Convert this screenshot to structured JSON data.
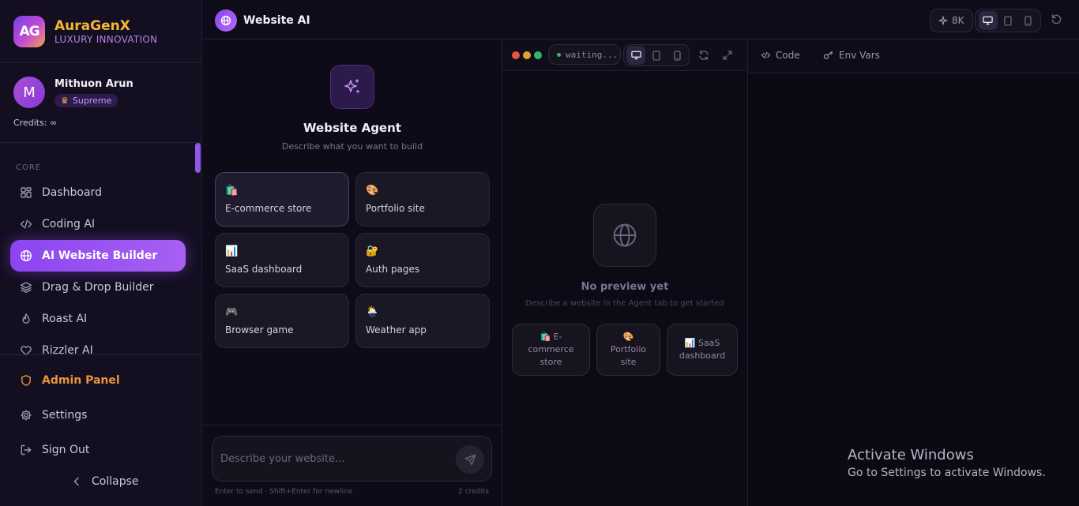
{
  "brand": {
    "logo_text": "AG",
    "name": "AuraGenX",
    "tagline": "LUXURY INNOVATION"
  },
  "user": {
    "avatar_initial": "M",
    "name": "Mithuon Arun",
    "badge": "Supreme",
    "credits": "Credits: ∞"
  },
  "sidebar": {
    "section": "CORE",
    "items": [
      {
        "label": "Dashboard",
        "icon": "grid-icon"
      },
      {
        "label": "Coding AI",
        "icon": "code-icon"
      },
      {
        "label": "AI Website Builder",
        "icon": "globe-icon",
        "active": true
      },
      {
        "label": "Drag & Drop Builder",
        "icon": "layers-icon"
      },
      {
        "label": "Roast AI",
        "icon": "flame-icon"
      },
      {
        "label": "Rizzler AI",
        "icon": "heart-icon"
      }
    ],
    "footer": [
      {
        "label": "Admin Panel",
        "icon": "shield-icon"
      },
      {
        "label": "Settings",
        "icon": "gear-icon"
      },
      {
        "label": "Sign Out",
        "icon": "sign-out-icon"
      }
    ],
    "collapse": "Collapse"
  },
  "topbar": {
    "title": "Website AI",
    "quality": "8K"
  },
  "agent": {
    "title": "Website Agent",
    "subtitle": "Describe what you want to build",
    "templates": [
      {
        "emoji": "🛍️",
        "label": "E-commerce store"
      },
      {
        "emoji": "🎨",
        "label": "Portfolio site"
      },
      {
        "emoji": "📊",
        "label": "SaaS dashboard"
      },
      {
        "emoji": "🔐",
        "label": "Auth pages"
      },
      {
        "emoji": "🎮",
        "label": "Browser game"
      },
      {
        "emoji": "🌦️",
        "label": "Weather app"
      }
    ],
    "input_placeholder": "Describe your website...",
    "hint": "Enter to send · Shift+Enter for newline",
    "cost": "2 credits"
  },
  "preview": {
    "status": "waiting...",
    "empty_title": "No preview yet",
    "empty_sub": "Describe a website in the Agent tab to get started",
    "chips": [
      {
        "emoji": "🛍️",
        "label": "E-commerce store"
      },
      {
        "emoji": "🎨",
        "label": "Portfolio site"
      },
      {
        "emoji": "📊",
        "label": "SaaS dashboard"
      }
    ]
  },
  "code": {
    "tabs": [
      "Code",
      "Env Vars"
    ]
  },
  "os_overlay": {
    "line1": "Activate Windows",
    "line2": "Go to Settings to activate Windows."
  },
  "colors": {
    "accent": "#8b45f0",
    "gold": "#f4b634",
    "admin": "#e8943a",
    "background": "#0d0b17"
  }
}
